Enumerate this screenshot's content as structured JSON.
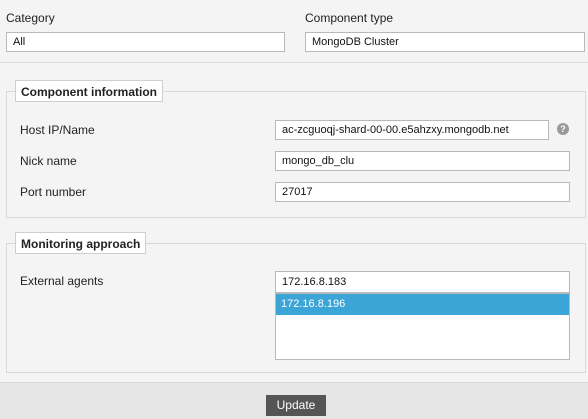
{
  "top": {
    "category_label": "Category",
    "category_value": "All",
    "component_type_label": "Component type",
    "component_type_value": "MongoDB Cluster"
  },
  "component_info": {
    "legend": "Component information",
    "host_label": "Host IP/Name",
    "host_value": "ac-zcguoqj-shard-00-00.e5ahzxy.mongodb.net",
    "help_glyph": "?",
    "nick_label": "Nick name",
    "nick_value": "mongo_db_clu",
    "port_label": "Port number",
    "port_value": "27017"
  },
  "monitoring": {
    "legend": "Monitoring approach",
    "agents_label": "External agents",
    "agents": [
      "172.16.8.183",
      "172.16.8.196"
    ],
    "selected_index": 1,
    "selected_color": "#3aa5d6"
  },
  "footer": {
    "update_label": "Update"
  }
}
